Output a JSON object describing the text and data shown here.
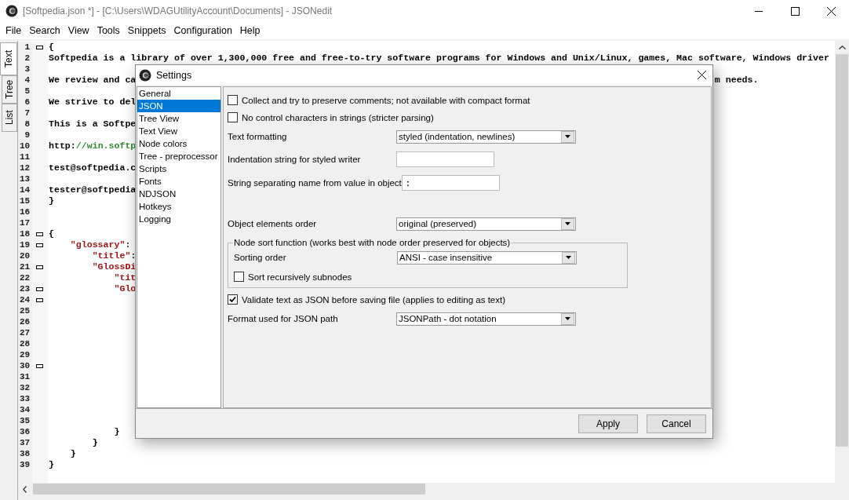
{
  "window": {
    "title": "[Softpedia.json *] - [C:\\Users\\WDAGUtilityAccount\\Documents] - JSONedit"
  },
  "menu": [
    "File",
    "Search",
    "View",
    "Tools",
    "Snippets",
    "Configuration",
    "Help"
  ],
  "side_tabs": [
    {
      "label": "Text",
      "selected": true
    },
    {
      "label": "Tree",
      "selected": false
    },
    {
      "label": "List",
      "selected": false
    }
  ],
  "editor": {
    "lines": [
      {
        "number": "1",
        "fold": true,
        "parts": [
          {
            "kind": "plain",
            "text": "{"
          }
        ]
      },
      {
        "number": "2",
        "fold": false,
        "parts": [
          {
            "kind": "plain",
            "text": "Softpedia is a library of over 1,300,000 free and free-to-try software programs for Windows and Unix/Linux, games, Mac software, Windows driver"
          }
        ]
      },
      {
        "number": "3",
        "fold": false
      },
      {
        "number": "4",
        "fold": false,
        "parts": [
          {
            "kind": "plain",
            "text": "We review and ca"
          }
        ],
        "tail": "m needs."
      },
      {
        "number": "5",
        "fold": false
      },
      {
        "number": "6",
        "fold": false,
        "parts": [
          {
            "kind": "plain",
            "text": "We strive to del"
          }
        ]
      },
      {
        "number": "7",
        "fold": false
      },
      {
        "number": "8",
        "fold": false,
        "parts": [
          {
            "kind": "plain",
            "text": "This is a Softpe"
          }
        ]
      },
      {
        "number": "9",
        "fold": false
      },
      {
        "number": "10",
        "fold": false,
        "parts": [
          {
            "kind": "plain",
            "text": "http:"
          },
          {
            "kind": "comment",
            "text": "//win.softp"
          }
        ]
      },
      {
        "number": "11",
        "fold": false
      },
      {
        "number": "12",
        "fold": false,
        "parts": [
          {
            "kind": "plain",
            "text": "test@softpedia.c"
          }
        ]
      },
      {
        "number": "13",
        "fold": false
      },
      {
        "number": "14",
        "fold": false,
        "parts": [
          {
            "kind": "plain",
            "text": "tester@softpedia"
          }
        ]
      },
      {
        "number": "15",
        "fold": false,
        "parts": [
          {
            "kind": "plain",
            "text": "}"
          }
        ]
      },
      {
        "number": "16",
        "fold": false
      },
      {
        "number": "17",
        "fold": false
      },
      {
        "number": "18",
        "fold": true,
        "parts": [
          {
            "kind": "plain",
            "text": "{"
          }
        ]
      },
      {
        "number": "19",
        "fold": true,
        "parts": [
          {
            "kind": "string",
            "text": "    \"glossary\""
          },
          {
            "kind": "plain",
            "text": ":"
          }
        ]
      },
      {
        "number": "20",
        "fold": false,
        "parts": [
          {
            "kind": "string",
            "text": "        \"title\""
          },
          {
            "kind": "plain",
            "text": ":"
          }
        ]
      },
      {
        "number": "21",
        "fold": true,
        "parts": [
          {
            "kind": "string",
            "text": "        \"GlossDi"
          }
        ]
      },
      {
        "number": "22",
        "fold": false,
        "parts": [
          {
            "kind": "string",
            "text": "            \"tit"
          }
        ]
      },
      {
        "number": "23",
        "fold": true,
        "parts": [
          {
            "kind": "string",
            "text": "            \"Glo"
          }
        ]
      },
      {
        "number": "24",
        "fold": true
      },
      {
        "number": "25",
        "fold": false
      },
      {
        "number": "26",
        "fold": false
      },
      {
        "number": "27",
        "fold": false
      },
      {
        "number": "28",
        "fold": false
      },
      {
        "number": "29",
        "fold": false
      },
      {
        "number": "30",
        "fold": true
      },
      {
        "number": "31",
        "fold": false
      },
      {
        "number": "32",
        "fold": false
      },
      {
        "number": "33",
        "fold": false
      },
      {
        "number": "34",
        "fold": false
      },
      {
        "number": "35",
        "fold": false
      },
      {
        "number": "36",
        "fold": false,
        "parts": [
          {
            "kind": "plain",
            "text": "            }"
          }
        ]
      },
      {
        "number": "37",
        "fold": false,
        "parts": [
          {
            "kind": "plain",
            "text": "        }"
          }
        ]
      },
      {
        "number": "38",
        "fold": false,
        "parts": [
          {
            "kind": "plain",
            "text": "    }"
          }
        ]
      },
      {
        "number": "39",
        "fold": false,
        "parts": [
          {
            "kind": "plain",
            "text": "}"
          }
        ]
      }
    ]
  },
  "dialog": {
    "title": "Settings",
    "categories": [
      {
        "label": "General",
        "selected": false
      },
      {
        "label": "JSON",
        "selected": true
      },
      {
        "label": "Tree View",
        "selected": false
      },
      {
        "label": "Text View",
        "selected": false
      },
      {
        "label": "Node colors",
        "selected": false
      },
      {
        "label": "Tree - preprocessor",
        "selected": false
      },
      {
        "label": "Scripts",
        "selected": false
      },
      {
        "label": "Fonts",
        "selected": false
      },
      {
        "label": "NDJSON",
        "selected": false
      },
      {
        "label": "Hotkeys",
        "selected": false
      },
      {
        "label": "Logging",
        "selected": false
      }
    ],
    "settings": [
      {
        "kind": "checkbox",
        "label": "Collect and try to preserve comments; not available with compact format",
        "checked": false
      },
      {
        "kind": "checkbox",
        "label": "No control characters in strings (stricter parsing)",
        "checked": false
      },
      {
        "kind": "select",
        "label": "Text formatting",
        "value": "styled (indentation, newlines)"
      },
      {
        "kind": "text",
        "label": "Indentation string for styled writer"
      },
      {
        "kind": "text",
        "label": "String separating name from value in object",
        "value": " :"
      },
      {
        "kind": "spacer"
      },
      {
        "kind": "select",
        "label": "Object elements order",
        "value": "original (preserved)"
      },
      {
        "kind": "group",
        "label": "Node sort function (works best with node order preserved for objects)",
        "children": [
          {
            "kind": "select",
            "label": "Sorting order",
            "value": "ANSI - case insensitive"
          },
          {
            "kind": "checkbox",
            "label": "Sort recursively subnodes",
            "checked": false
          }
        ]
      },
      {
        "kind": "checkbox",
        "label": "Validate text as JSON before saving file (applies to editing as text)",
        "checked": true
      },
      {
        "kind": "select",
        "label": "Format used for JSON path",
        "value": "JSONPath - dot notation"
      }
    ],
    "buttons": [
      "Apply",
      "Cancel"
    ]
  }
}
